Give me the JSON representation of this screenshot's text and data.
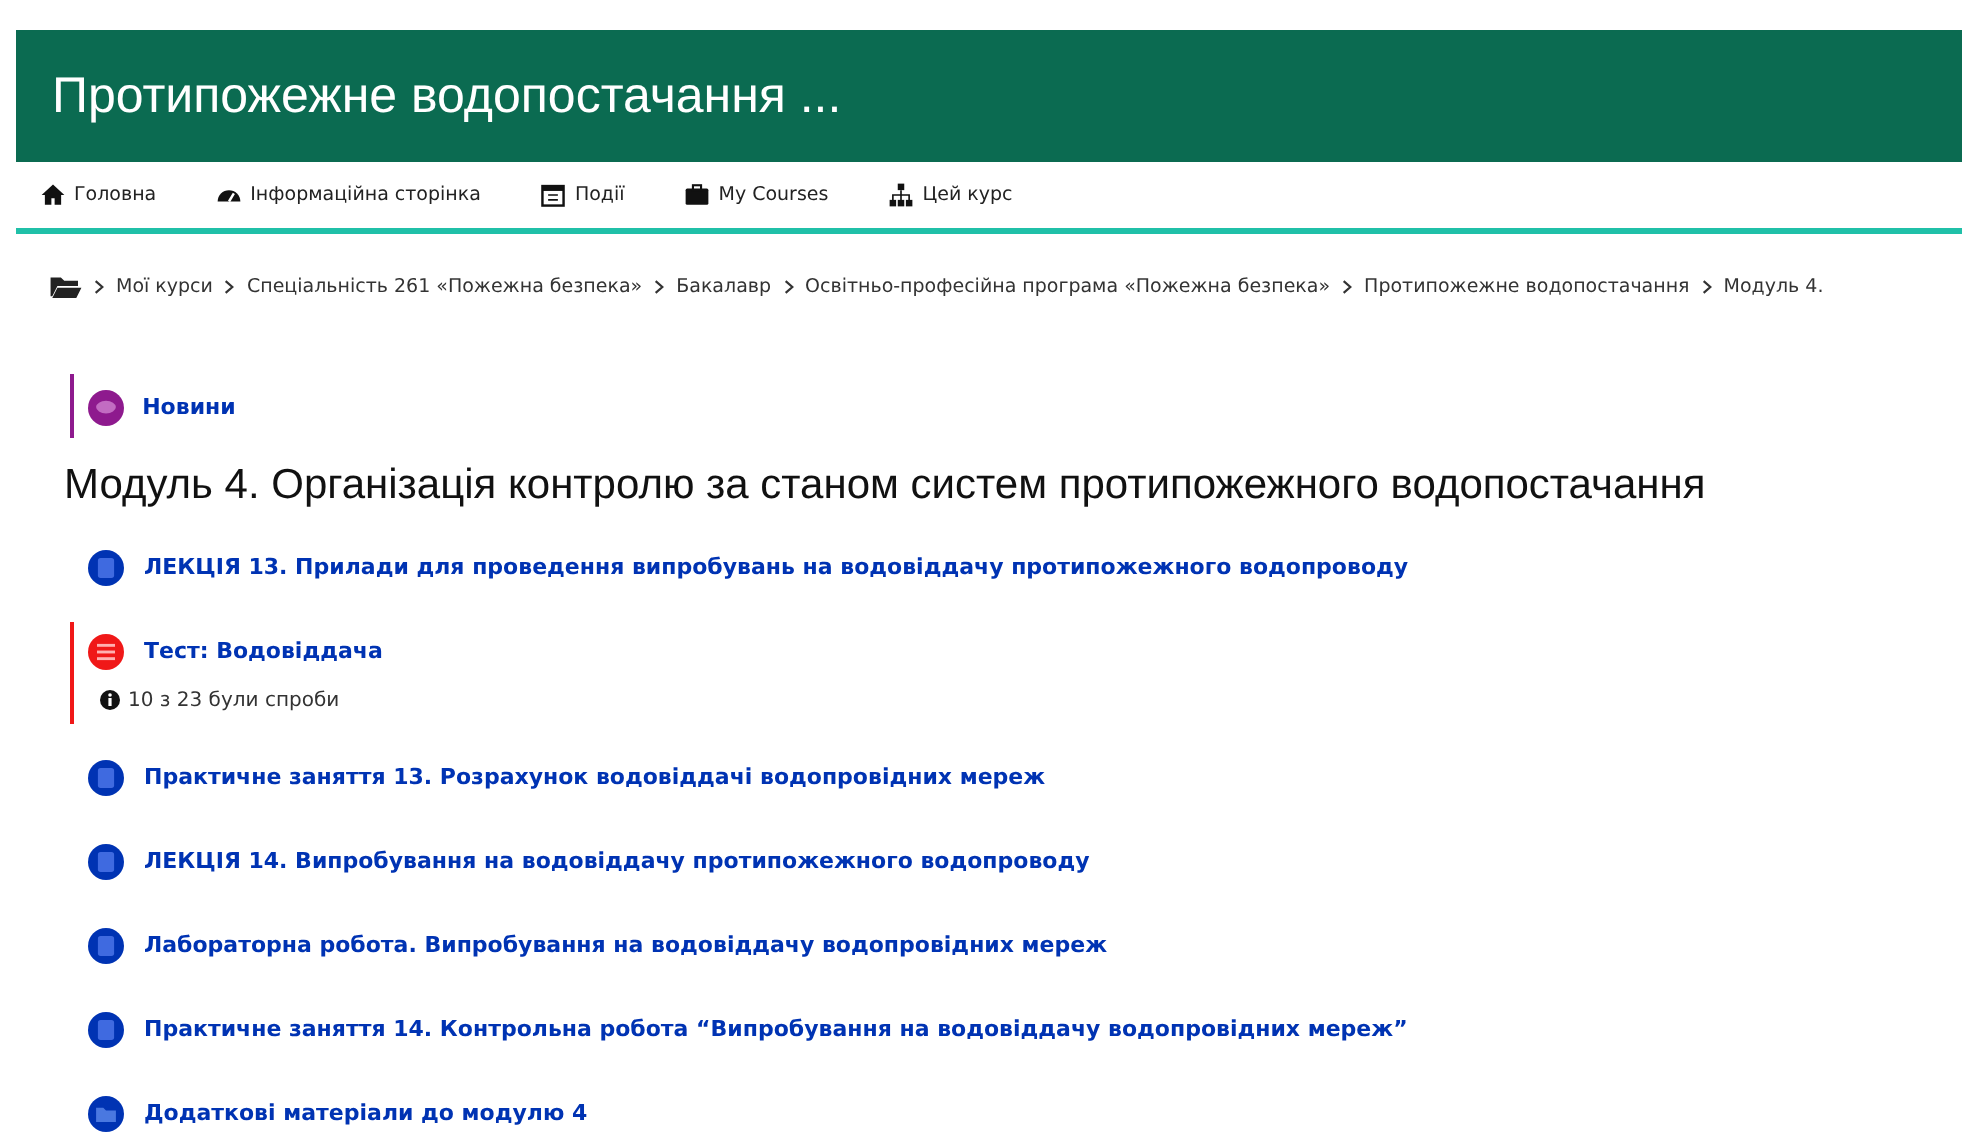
{
  "header": {
    "title": "Протипожежне водопостачання ..."
  },
  "nav": [
    {
      "label": "Головна",
      "kind": "home"
    },
    {
      "label": "Інформаційна сторінка",
      "kind": "gauge"
    },
    {
      "label": "Події",
      "kind": "calendar"
    },
    {
      "label": "My Courses",
      "kind": "briefcase"
    },
    {
      "label": "Цей курс",
      "kind": "sitemap"
    }
  ],
  "breadcrumb": [
    "Мої курси",
    "Спеціальність 261 «Пожежна безпека»",
    "Бакалавр",
    "Освітньо-професійна програма «Пожежна безпека»",
    "Протипожежне водопостачання",
    "Модуль 4."
  ],
  "news": {
    "label": "Новини",
    "kind": "forum"
  },
  "section": {
    "title": "Модуль 4. Організація контролю за станом систем протипожежного водопостачання",
    "activities": [
      {
        "kind": "page",
        "label": "ЛЕКЦІЯ 13. Прилади для проведення випробувань на водовіддачу протипожежного водопроводу"
      },
      {
        "kind": "quiz",
        "label": "Тест: Водовіддача",
        "note": "10 з 23 були спроби"
      },
      {
        "kind": "page",
        "label": "Практичне заняття 13. Розрахунок водовіддачі водопровідних мереж"
      },
      {
        "kind": "page",
        "label": "ЛЕКЦІЯ 14. Випробування на водовіддачу протипожежного водопроводу"
      },
      {
        "kind": "page",
        "label": "Лабораторна робота. Випробування на водовіддачу водопровідних мереж"
      },
      {
        "kind": "page",
        "label": "Практичне заняття 14. Контрольна робота “Випробування на водовіддачу водопровідних мереж”"
      },
      {
        "kind": "folder",
        "label": "Додаткові матеріали до модулю 4"
      }
    ]
  }
}
